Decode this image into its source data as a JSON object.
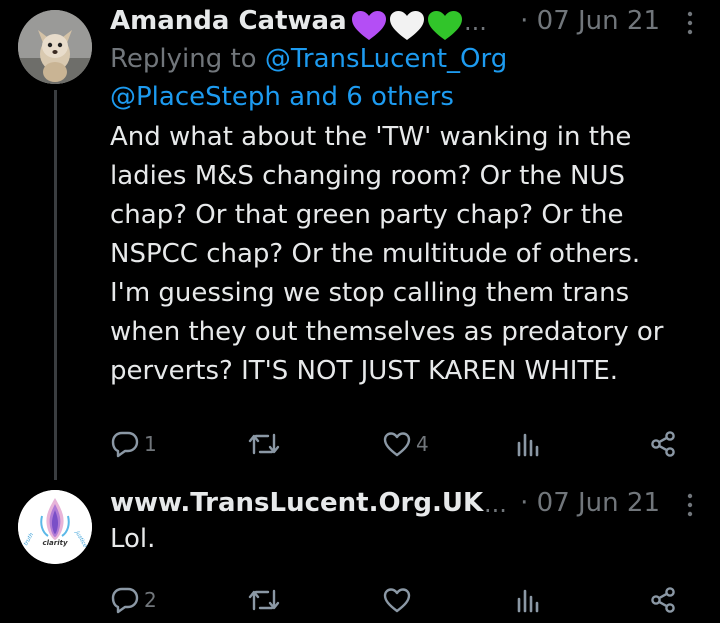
{
  "tweets": [
    {
      "display_name": "Amanda Catwaa",
      "emoji": [
        "purple-heart",
        "white-heart",
        "green-heart"
      ],
      "ellipsis": "...",
      "date": "· 07 Jun 21",
      "replying_prefix": "Replying to ",
      "replying_to": "@TransLucent_Org",
      "replying_line2": "@PlaceSteph and 6 others",
      "text": "And what about the 'TW' wanking in the\nladies M&S changing room? Or the NUS\nchap? Or that green party chap? Or the\nNSPCC chap? Or the multitude of others.\nI'm guessing we stop calling them trans\nwhen they out themselves as predatory or\nperverts? IT'S NOT JUST KAREN WHITE.",
      "actions": {
        "replies": "1",
        "reposts": "",
        "likes": "4",
        "views": "",
        "share": ""
      }
    },
    {
      "display_name": "www.TransLucent.Org.UK",
      "ellipsis": "...",
      "date": "· 07 Jun 21",
      "avatar_text": {
        "left": "truth",
        "middle": "clarity",
        "right": "justice"
      },
      "text": "Lol.",
      "actions": {
        "replies": "2",
        "reposts": "",
        "likes": "",
        "views": "",
        "share": ""
      }
    }
  ],
  "colors": {
    "background": "#000000",
    "text": "#e7e9ea",
    "muted": "#71767b",
    "link": "#1d9bf0",
    "purple_heart": "#a855f7",
    "green_heart": "#22c55e"
  }
}
